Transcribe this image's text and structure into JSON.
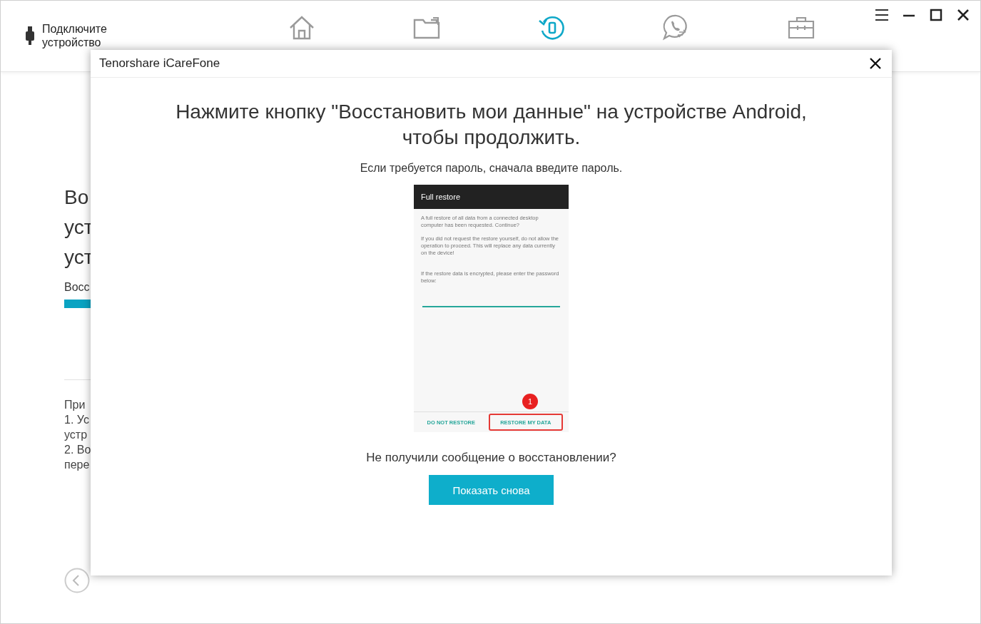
{
  "header": {
    "device_prompt": "Подключите устройство",
    "tabs": [
      {
        "kind": "home",
        "selected": false
      },
      {
        "kind": "folder",
        "selected": false
      },
      {
        "kind": "restore",
        "selected": true
      },
      {
        "kind": "chat",
        "selected": false
      },
      {
        "kind": "toolbox",
        "selected": false
      }
    ]
  },
  "background": {
    "heading_lines": [
      "Во",
      "уст",
      "уст"
    ],
    "status": "Восс",
    "note_lines": [
      "При",
      "1. Ус",
      "устр",
      "2. Во",
      "пере"
    ]
  },
  "dialog": {
    "title": "Tenorshare iCareFone",
    "heading": "Нажмите кнопку \"Восстановить мои данные\" на устройстве Android, чтобы продолжить.",
    "subtitle": "Если требуется пароль, сначала введите пароль.",
    "phone": {
      "title": "Full restore",
      "paragraphs": [
        "A full restore of all data from a connected desktop computer has been requested. Continue?",
        "If you did not request the restore yourself, do not allow the operation to proceed. This will replace any data currently on the device!",
        "If the restore data is encrypted, please enter the password below:"
      ],
      "buttons": [
        "DO NOT RESTORE",
        "RESTORE MY DATA"
      ],
      "step_badge": "1"
    },
    "question": "Не получили сообщение о восстановлении?",
    "button": "Показать снова"
  }
}
